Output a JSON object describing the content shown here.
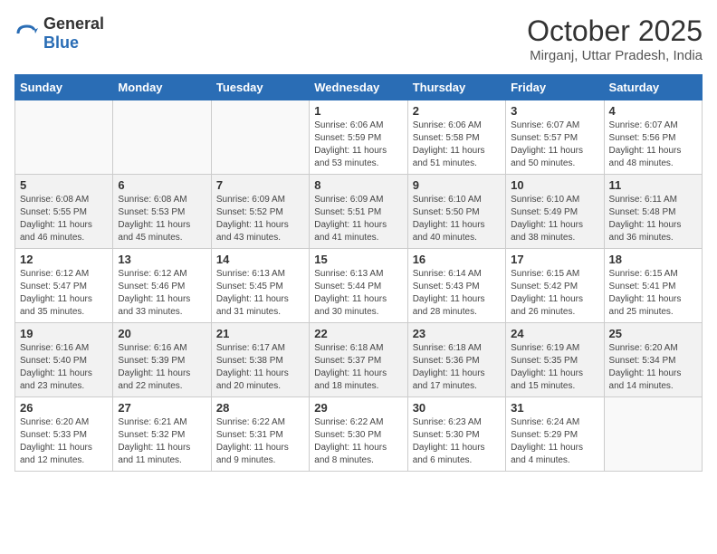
{
  "header": {
    "logo_general": "General",
    "logo_blue": "Blue",
    "month": "October 2025",
    "location": "Mirganj, Uttar Pradesh, India"
  },
  "days_of_week": [
    "Sunday",
    "Monday",
    "Tuesday",
    "Wednesday",
    "Thursday",
    "Friday",
    "Saturday"
  ],
  "weeks": [
    [
      {
        "num": "",
        "info": ""
      },
      {
        "num": "",
        "info": ""
      },
      {
        "num": "",
        "info": ""
      },
      {
        "num": "1",
        "info": "Sunrise: 6:06 AM\nSunset: 5:59 PM\nDaylight: 11 hours\nand 53 minutes."
      },
      {
        "num": "2",
        "info": "Sunrise: 6:06 AM\nSunset: 5:58 PM\nDaylight: 11 hours\nand 51 minutes."
      },
      {
        "num": "3",
        "info": "Sunrise: 6:07 AM\nSunset: 5:57 PM\nDaylight: 11 hours\nand 50 minutes."
      },
      {
        "num": "4",
        "info": "Sunrise: 6:07 AM\nSunset: 5:56 PM\nDaylight: 11 hours\nand 48 minutes."
      }
    ],
    [
      {
        "num": "5",
        "info": "Sunrise: 6:08 AM\nSunset: 5:55 PM\nDaylight: 11 hours\nand 46 minutes."
      },
      {
        "num": "6",
        "info": "Sunrise: 6:08 AM\nSunset: 5:53 PM\nDaylight: 11 hours\nand 45 minutes."
      },
      {
        "num": "7",
        "info": "Sunrise: 6:09 AM\nSunset: 5:52 PM\nDaylight: 11 hours\nand 43 minutes."
      },
      {
        "num": "8",
        "info": "Sunrise: 6:09 AM\nSunset: 5:51 PM\nDaylight: 11 hours\nand 41 minutes."
      },
      {
        "num": "9",
        "info": "Sunrise: 6:10 AM\nSunset: 5:50 PM\nDaylight: 11 hours\nand 40 minutes."
      },
      {
        "num": "10",
        "info": "Sunrise: 6:10 AM\nSunset: 5:49 PM\nDaylight: 11 hours\nand 38 minutes."
      },
      {
        "num": "11",
        "info": "Sunrise: 6:11 AM\nSunset: 5:48 PM\nDaylight: 11 hours\nand 36 minutes."
      }
    ],
    [
      {
        "num": "12",
        "info": "Sunrise: 6:12 AM\nSunset: 5:47 PM\nDaylight: 11 hours\nand 35 minutes."
      },
      {
        "num": "13",
        "info": "Sunrise: 6:12 AM\nSunset: 5:46 PM\nDaylight: 11 hours\nand 33 minutes."
      },
      {
        "num": "14",
        "info": "Sunrise: 6:13 AM\nSunset: 5:45 PM\nDaylight: 11 hours\nand 31 minutes."
      },
      {
        "num": "15",
        "info": "Sunrise: 6:13 AM\nSunset: 5:44 PM\nDaylight: 11 hours\nand 30 minutes."
      },
      {
        "num": "16",
        "info": "Sunrise: 6:14 AM\nSunset: 5:43 PM\nDaylight: 11 hours\nand 28 minutes."
      },
      {
        "num": "17",
        "info": "Sunrise: 6:15 AM\nSunset: 5:42 PM\nDaylight: 11 hours\nand 26 minutes."
      },
      {
        "num": "18",
        "info": "Sunrise: 6:15 AM\nSunset: 5:41 PM\nDaylight: 11 hours\nand 25 minutes."
      }
    ],
    [
      {
        "num": "19",
        "info": "Sunrise: 6:16 AM\nSunset: 5:40 PM\nDaylight: 11 hours\nand 23 minutes."
      },
      {
        "num": "20",
        "info": "Sunrise: 6:16 AM\nSunset: 5:39 PM\nDaylight: 11 hours\nand 22 minutes."
      },
      {
        "num": "21",
        "info": "Sunrise: 6:17 AM\nSunset: 5:38 PM\nDaylight: 11 hours\nand 20 minutes."
      },
      {
        "num": "22",
        "info": "Sunrise: 6:18 AM\nSunset: 5:37 PM\nDaylight: 11 hours\nand 18 minutes."
      },
      {
        "num": "23",
        "info": "Sunrise: 6:18 AM\nSunset: 5:36 PM\nDaylight: 11 hours\nand 17 minutes."
      },
      {
        "num": "24",
        "info": "Sunrise: 6:19 AM\nSunset: 5:35 PM\nDaylight: 11 hours\nand 15 minutes."
      },
      {
        "num": "25",
        "info": "Sunrise: 6:20 AM\nSunset: 5:34 PM\nDaylight: 11 hours\nand 14 minutes."
      }
    ],
    [
      {
        "num": "26",
        "info": "Sunrise: 6:20 AM\nSunset: 5:33 PM\nDaylight: 11 hours\nand 12 minutes."
      },
      {
        "num": "27",
        "info": "Sunrise: 6:21 AM\nSunset: 5:32 PM\nDaylight: 11 hours\nand 11 minutes."
      },
      {
        "num": "28",
        "info": "Sunrise: 6:22 AM\nSunset: 5:31 PM\nDaylight: 11 hours\nand 9 minutes."
      },
      {
        "num": "29",
        "info": "Sunrise: 6:22 AM\nSunset: 5:30 PM\nDaylight: 11 hours\nand 8 minutes."
      },
      {
        "num": "30",
        "info": "Sunrise: 6:23 AM\nSunset: 5:30 PM\nDaylight: 11 hours\nand 6 minutes."
      },
      {
        "num": "31",
        "info": "Sunrise: 6:24 AM\nSunset: 5:29 PM\nDaylight: 11 hours\nand 4 minutes."
      },
      {
        "num": "",
        "info": ""
      }
    ]
  ]
}
